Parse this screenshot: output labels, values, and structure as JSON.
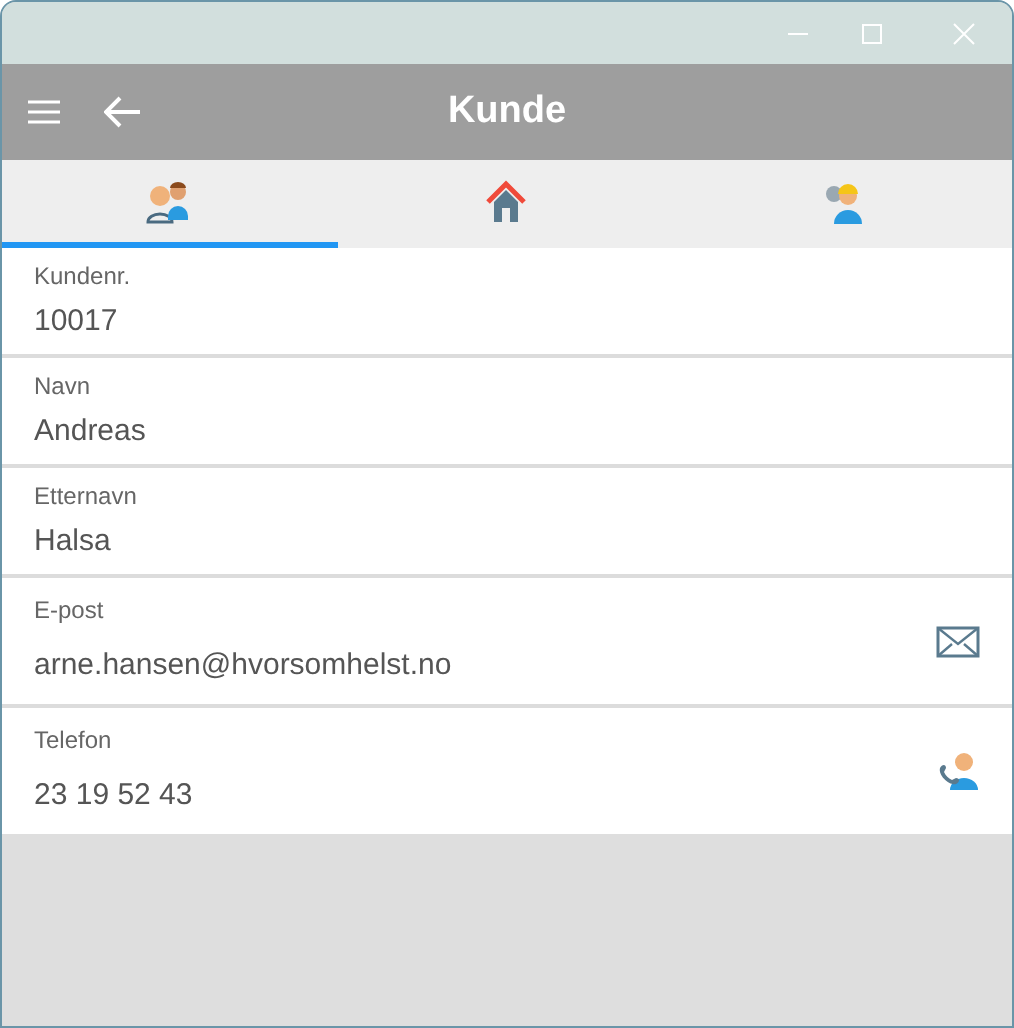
{
  "app_bar": {
    "title": "Kunde"
  },
  "tabs": [
    {
      "kind": "customer",
      "selected": true
    },
    {
      "kind": "house",
      "selected": false
    },
    {
      "kind": "worker",
      "selected": false
    }
  ],
  "fields": [
    {
      "label": "Kundenr.",
      "value": "10017",
      "kind": "plain"
    },
    {
      "label": "Navn",
      "value": "Andreas",
      "kind": "plain"
    },
    {
      "label": "Etternavn",
      "value": "Halsa",
      "kind": "plain"
    },
    {
      "label": "E-post",
      "value": "arne.hansen@hvorsomhelst.no",
      "kind": "email"
    },
    {
      "label": "Telefon",
      "value": "23 19 52 43",
      "kind": "phone"
    }
  ]
}
